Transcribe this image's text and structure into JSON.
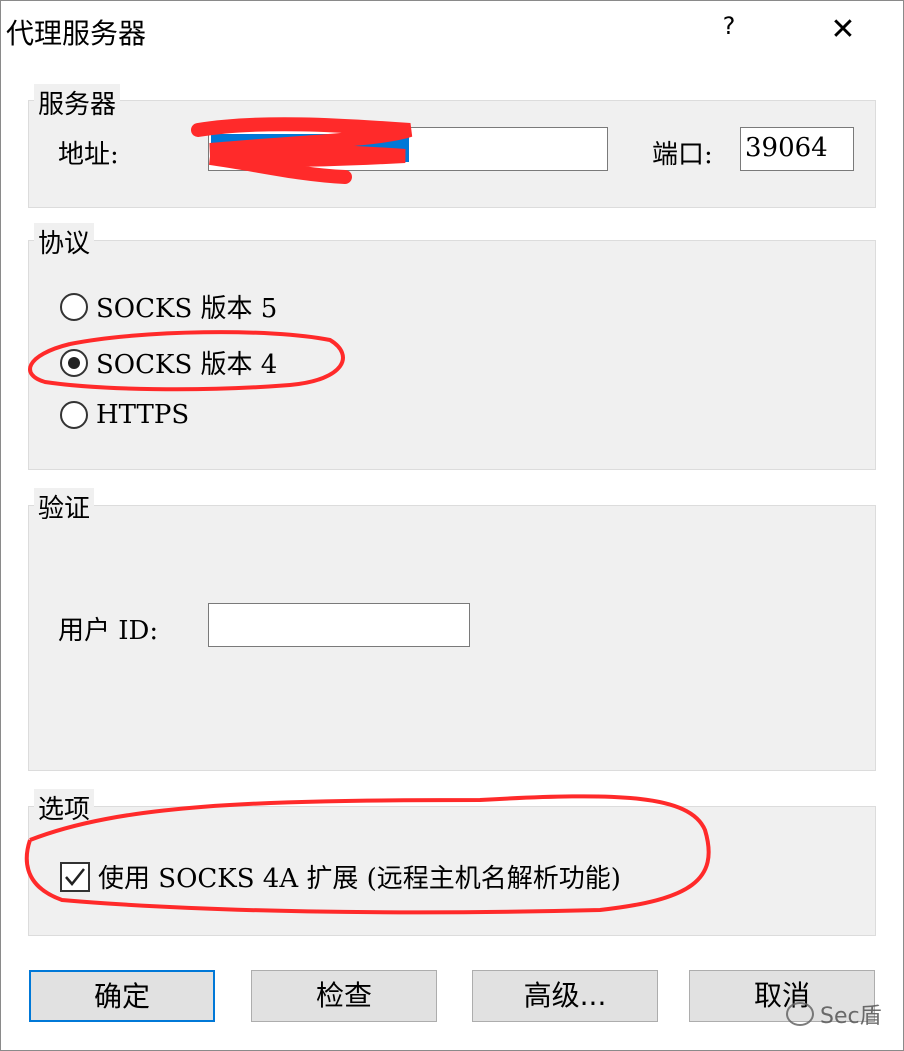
{
  "window": {
    "title": "代理服务器",
    "help": "?",
    "close": "✕"
  },
  "server": {
    "group_label": "服务器",
    "address_label": "地址:",
    "address_value": "",
    "port_label": "端口:",
    "port_value": "39064"
  },
  "protocol": {
    "group_label": "协议",
    "options": [
      {
        "label": "SOCKS 版本 5",
        "selected": false
      },
      {
        "label": "SOCKS 版本 4",
        "selected": true
      },
      {
        "label": "HTTPS",
        "selected": false
      }
    ]
  },
  "auth": {
    "group_label": "验证",
    "user_id_label": "用户 ID:",
    "user_id_value": ""
  },
  "options": {
    "group_label": "选项",
    "socks4a_label": "使用 SOCKS 4A 扩展 (远程主机名解析功能)",
    "socks4a_checked": true
  },
  "buttons": {
    "ok": "确定",
    "check": "检查",
    "advanced": "高级...",
    "cancel": "取消"
  },
  "watermark": "Sec盾",
  "colors": {
    "annotation_red": "#ff2a2a",
    "selection_blue": "#0078d7"
  }
}
